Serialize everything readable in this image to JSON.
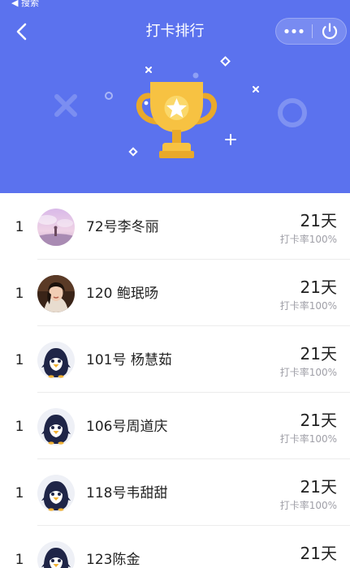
{
  "status_bar": {
    "back_label": "◀ 搜索"
  },
  "nav": {
    "title": "打卡排行",
    "back_icon": "chevron-left-icon",
    "more_icon": "more-dots-icon",
    "close_icon": "power-icon"
  },
  "colors": {
    "header_bg": "#5b72ee",
    "trophy": "#f7c242",
    "trophy_dark": "#e9a92a"
  },
  "list": [
    {
      "rank": "1",
      "name": "72号李冬丽",
      "days": "21天",
      "rate": "打卡率100%",
      "avatar": "photo-landscape"
    },
    {
      "rank": "1",
      "name": "120 鲍珉旸",
      "days": "21天",
      "rate": "打卡率100%",
      "avatar": "photo-portrait"
    },
    {
      "rank": "1",
      "name": "101号 杨慧茹",
      "days": "21天",
      "rate": "打卡率100%",
      "avatar": "penguin-icon"
    },
    {
      "rank": "1",
      "name": "106号周道庆",
      "days": "21天",
      "rate": "打卡率100%",
      "avatar": "penguin-icon"
    },
    {
      "rank": "1",
      "name": "118号韦甜甜",
      "days": "21天",
      "rate": "打卡率100%",
      "avatar": "penguin-icon"
    },
    {
      "rank": "1",
      "name": "123陈金",
      "days": "21天",
      "rate": "",
      "avatar": "penguin-icon"
    }
  ]
}
